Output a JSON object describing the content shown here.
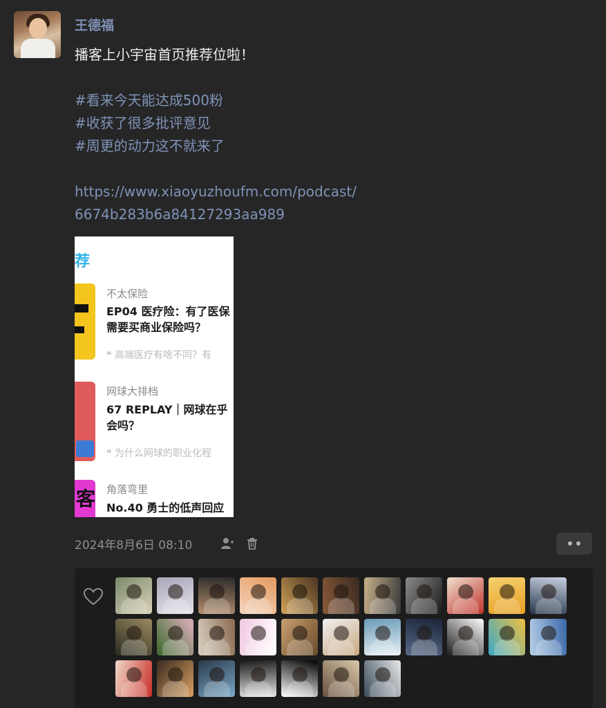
{
  "post": {
    "author": "王德福",
    "lines": [
      {
        "text": "播客上小宇宙首页推荐位啦！",
        "kind": "text"
      },
      {
        "text": "",
        "kind": "blank"
      },
      {
        "text": "#看来今天能达成500粉",
        "kind": "tag"
      },
      {
        "text": "#收获了很多批评意见",
        "kind": "tag"
      },
      {
        "text": "#周更的动力这不就来了",
        "kind": "tag"
      },
      {
        "text": "",
        "kind": "blank"
      },
      {
        "text": "https://www.xiaoyuzhoufm.com/podcast/",
        "kind": "link"
      },
      {
        "text": "6674b283b6a84127293aa989",
        "kind": "link"
      }
    ],
    "timestamp": "2024年8月6日 08:10"
  },
  "screenshot": {
    "header": "荐",
    "episodes": [
      {
        "podcast": "不太保险",
        "title1": "EP04 医疗险：有了医保",
        "title2": "需要买商业保险吗？",
        "quote": "❝ 高端医疗有啥不同？有"
      },
      {
        "podcast": "网球大排档",
        "title1": "67 REPLAY｜网球在乎",
        "title2": "会吗？",
        "quote": "❝ 为什么网球的职业化程"
      },
      {
        "podcast": "角落弯里",
        "title1": "No.40 勇士的低声回应",
        "title2": "",
        "quote": ""
      }
    ],
    "cover3_char": "客"
  },
  "icons": {
    "privacy": "person-icon",
    "delete": "trash-icon",
    "more": "more-dots-icon",
    "like": "heart-icon"
  },
  "colors": {
    "background": "#262626",
    "name": "#7d8fb3",
    "tag_link": "#7f93b8",
    "likes_panel": "#1c1c1c"
  },
  "liker_count": 29
}
